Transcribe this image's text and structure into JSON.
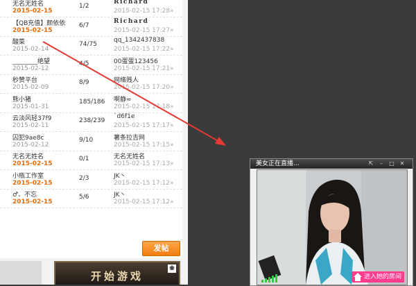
{
  "forum": {
    "rows": [
      {
        "title": "无名无姓名",
        "date": "2015-02-15",
        "date_highlight": true,
        "count": "1/2",
        "user": "Richard",
        "user_bold": true,
        "time": "2015-02-15 17:28»"
      },
      {
        "title": "【QB充值】颜依依",
        "date": "2015-02-15",
        "date_highlight": true,
        "count": "6/7",
        "user": "Richard",
        "user_bold": true,
        "time": "2015-02-15 17:27»"
      },
      {
        "title": "酸菜",
        "date": "2015-02-14",
        "date_highlight": false,
        "count": "74/75",
        "user": "qq_1342437838",
        "user_bold": false,
        "time": "2015-02-15 17:22»"
      },
      {
        "title": "________绝望",
        "date": "2015-02-12",
        "date_highlight": false,
        "count": "4/5",
        "user": "00蛋蛋123456",
        "user_bold": false,
        "time": "2015-02-15 17:21»"
      },
      {
        "title": "秒赞平台",
        "date": "2015-02-09",
        "date_highlight": false,
        "count": "8/9",
        "user": "网络贱人",
        "user_bold": false,
        "time": "2015-02-15 17:20»"
      },
      {
        "title": "熊小猪",
        "date": "2015-01-31",
        "date_highlight": false,
        "count": "185/186",
        "user": "啊静≈",
        "user_bold": false,
        "time": "2015-02-15 17:18»"
      },
      {
        "title": "云淡风轻37f9",
        "date": "2015-02-11",
        "date_highlight": false,
        "count": "238/239",
        "user": "`d6f1e",
        "user_bold": false,
        "time": "2015-02-15 17:17»"
      },
      {
        "title": "囚犯9ae8c",
        "date": "2015-02-12",
        "date_highlight": false,
        "count": "9/10",
        "user": "薯条拉吉网",
        "user_bold": false,
        "time": "2015-02-15 17:15»"
      },
      {
        "title": "无名无姓名",
        "date": "2015-02-15",
        "date_highlight": true,
        "count": "0/1",
        "user": "无名无姓名",
        "user_bold": false,
        "time": "2015-02-15 17:13»"
      },
      {
        "title": "小瓶工作室",
        "date": "2015-02-15",
        "date_highlight": true,
        "count": "2/3",
        "user": "JK丶",
        "user_bold": false,
        "time": "2015-02-15 17:12»"
      },
      {
        "title": "♂、不忘",
        "date": "2015-02-15",
        "date_highlight": true,
        "count": "5/6",
        "user": "JK丶",
        "user_bold": false,
        "time": "2015-02-15 17:12»"
      }
    ],
    "reply_button": "发帖",
    "banner_text": "开始游戏",
    "banner_icon": "paw-icon"
  },
  "popup": {
    "title": "美女正在直播...",
    "controls": [
      "pin",
      "minimize",
      "maximize",
      "close"
    ],
    "enter_button": "进入她的房间",
    "signal_bars": 5
  },
  "colors": {
    "accent_orange": "#e46c0a",
    "button_orange": "#f07c0e",
    "enter_pink": "#ff3d8e",
    "arrow_red": "#e53935",
    "backdrop": "#3a3a3a"
  }
}
